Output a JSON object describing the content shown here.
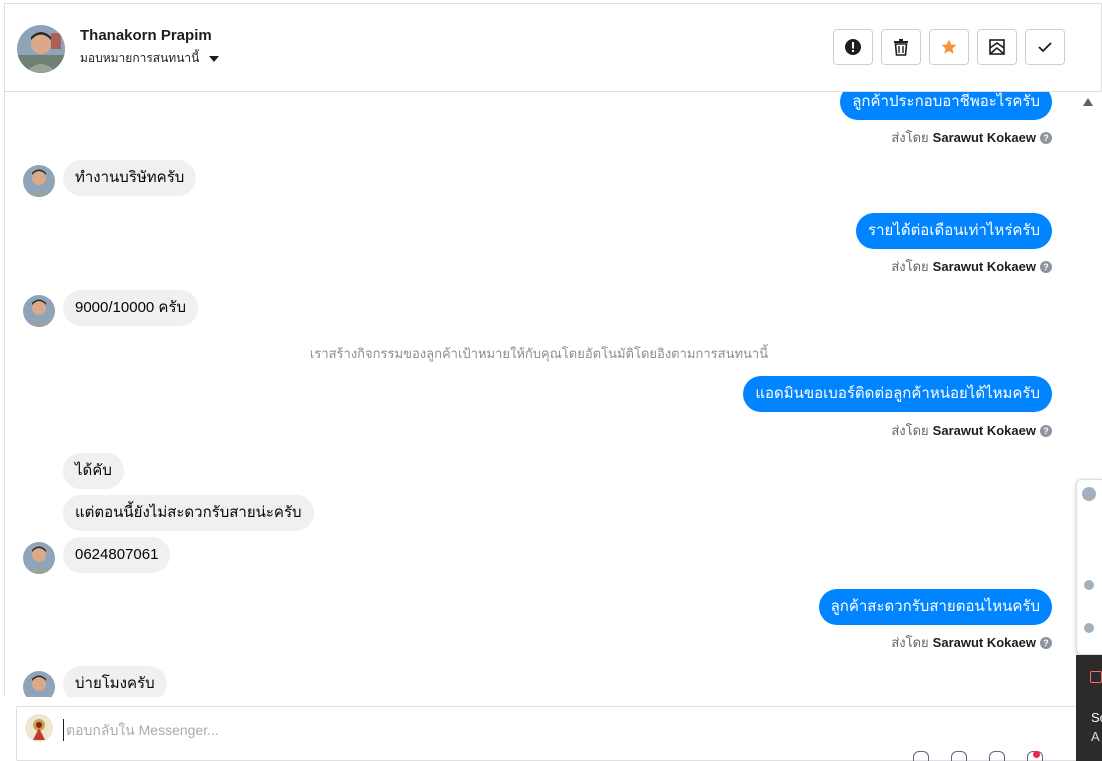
{
  "header": {
    "name": "Thanakorn Prapim",
    "assign_label": "มอบหมายการสนทนานี้",
    "actions": [
      "spam-button",
      "delete-button",
      "star-button",
      "mark-unread-button",
      "done-button"
    ]
  },
  "messages": {
    "out1": "ลูกค้าประกอบอาชีพอะไรครับ",
    "sent_by_prefix": "ส่งโดย",
    "agent": "Sarawut Kokaew",
    "in1": "ทำงานบริษัทครับ",
    "out2": "รายได้ต่อเดือนเท่าไหร่ครับ",
    "in2": "9000/10000 ครับ",
    "system_note": "เราสร้างกิจกรรมของลูกค้าเป้าหมายให้กับคุณโดยอัตโนมัติโดยอิงตามการสนทนานี้",
    "out3": "แอดมินขอเบอร์ติดต่อลูกค้าหน่อยได้ไหมครับ",
    "in3a": "ได้คับ",
    "in3b": "แต่ตอนนี้ยังไม่สะดวกรับสายน่ะครับ",
    "in3c": "0624807061",
    "out4": "ลูกค้าสะดวกรับสายตอนไหนครับ",
    "in4": "บ่ายโมงครับ"
  },
  "composer": {
    "placeholder": "ตอบกลับใน Messenger..."
  },
  "toast": {
    "line1": "Sc",
    "line2": "A"
  },
  "colors": {
    "outgoing_bubble": "#0084ff",
    "incoming_bubble": "#f0f0f0",
    "star": "#f7923b",
    "notification_dot": "#f02849"
  }
}
